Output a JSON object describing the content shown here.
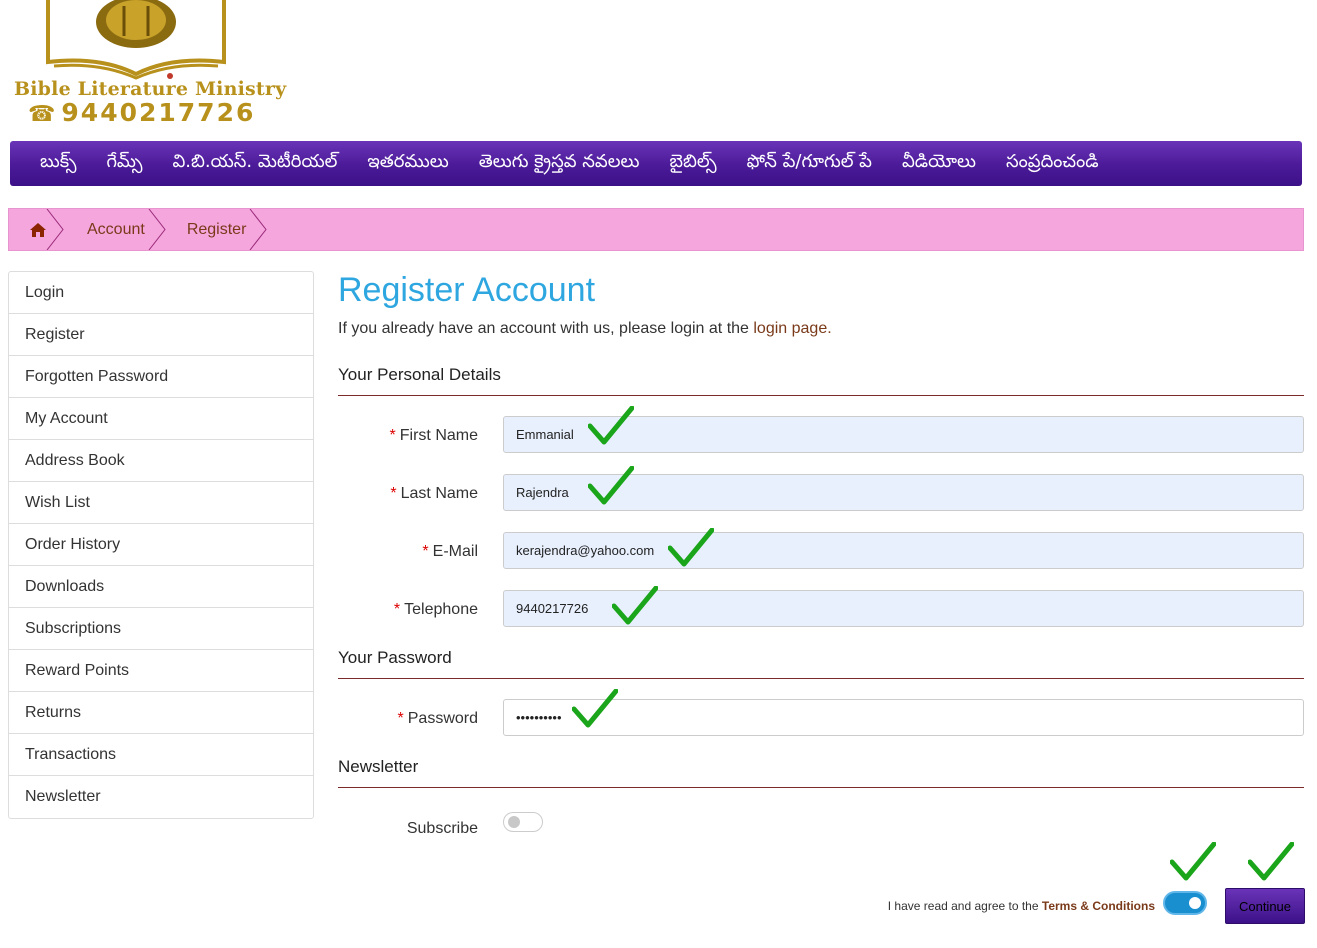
{
  "logo": {
    "title": "Bible Literature Ministry",
    "phone_icon": "☎",
    "phone": "9440217726"
  },
  "nav": {
    "items": [
      "బుక్స్",
      "గేమ్స్",
      "వి.బి.యస్. మెటీరియల్",
      "ఇతరములు",
      "తెలుగు క్రైస్తవ నవలలు",
      "బైబిల్స్",
      "ఫోన్ పే/గూగుల్ పే",
      "వీడియోలు",
      "సంప్రదించండి"
    ]
  },
  "breadcrumb": {
    "home_icon": "home-icon",
    "items": [
      "Account",
      "Register"
    ]
  },
  "sidebar": {
    "items": [
      "Login",
      "Register",
      "Forgotten Password",
      "My Account",
      "Address Book",
      "Wish List",
      "Order History",
      "Downloads",
      "Subscriptions",
      "Reward Points",
      "Returns",
      "Transactions",
      "Newsletter"
    ]
  },
  "main": {
    "title": "Register Account",
    "intro_text": "If you already have an account with us, please login at the ",
    "intro_link": "login page.",
    "personal": {
      "legend": "Your Personal Details",
      "first_name": {
        "label": "First Name",
        "value": "Emmanial"
      },
      "last_name": {
        "label": "Last Name",
        "value": "Rajendra"
      },
      "email": {
        "label": "E-Mail",
        "value": "kerajendra@yahoo.com"
      },
      "telephone": {
        "label": "Telephone",
        "value": "9440217726"
      }
    },
    "password": {
      "legend": "Your Password",
      "label": "Password",
      "value": "••••••••••"
    },
    "newsletter": {
      "legend": "Newsletter",
      "subscribe_label": "Subscribe",
      "subscribe_on": false
    },
    "agree": {
      "text": "I have read and agree to the ",
      "link": "Terms & Conditions",
      "on": true
    },
    "continue_label": "Continue",
    "required_marker": "*"
  },
  "colors": {
    "nav": "#4b1a98",
    "breadcrumb_bg": "#f4a6dd",
    "title": "#2ea6e0",
    "link": "#7a3a1a",
    "logo_gold": "#b8911c",
    "check_green": "#1aa51a"
  }
}
